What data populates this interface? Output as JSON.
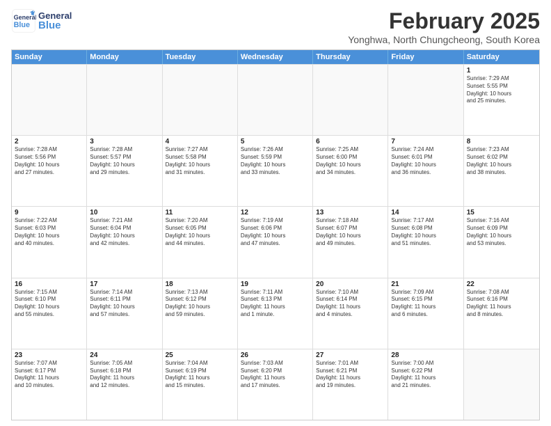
{
  "header": {
    "logo_general": "General",
    "logo_blue": "Blue",
    "title": "February 2025",
    "subtitle": "Yonghwa, North Chungcheong, South Korea"
  },
  "days_of_week": [
    "Sunday",
    "Monday",
    "Tuesday",
    "Wednesday",
    "Thursday",
    "Friday",
    "Saturday"
  ],
  "weeks": [
    [
      {
        "num": "",
        "text": "",
        "empty": true
      },
      {
        "num": "",
        "text": "",
        "empty": true
      },
      {
        "num": "",
        "text": "",
        "empty": true
      },
      {
        "num": "",
        "text": "",
        "empty": true
      },
      {
        "num": "",
        "text": "",
        "empty": true
      },
      {
        "num": "",
        "text": "",
        "empty": true
      },
      {
        "num": "1",
        "text": "Sunrise: 7:29 AM\nSunset: 5:55 PM\nDaylight: 10 hours\nand 25 minutes."
      }
    ],
    [
      {
        "num": "2",
        "text": "Sunrise: 7:28 AM\nSunset: 5:56 PM\nDaylight: 10 hours\nand 27 minutes."
      },
      {
        "num": "3",
        "text": "Sunrise: 7:28 AM\nSunset: 5:57 PM\nDaylight: 10 hours\nand 29 minutes."
      },
      {
        "num": "4",
        "text": "Sunrise: 7:27 AM\nSunset: 5:58 PM\nDaylight: 10 hours\nand 31 minutes."
      },
      {
        "num": "5",
        "text": "Sunrise: 7:26 AM\nSunset: 5:59 PM\nDaylight: 10 hours\nand 33 minutes."
      },
      {
        "num": "6",
        "text": "Sunrise: 7:25 AM\nSunset: 6:00 PM\nDaylight: 10 hours\nand 34 minutes."
      },
      {
        "num": "7",
        "text": "Sunrise: 7:24 AM\nSunset: 6:01 PM\nDaylight: 10 hours\nand 36 minutes."
      },
      {
        "num": "8",
        "text": "Sunrise: 7:23 AM\nSunset: 6:02 PM\nDaylight: 10 hours\nand 38 minutes."
      }
    ],
    [
      {
        "num": "9",
        "text": "Sunrise: 7:22 AM\nSunset: 6:03 PM\nDaylight: 10 hours\nand 40 minutes."
      },
      {
        "num": "10",
        "text": "Sunrise: 7:21 AM\nSunset: 6:04 PM\nDaylight: 10 hours\nand 42 minutes."
      },
      {
        "num": "11",
        "text": "Sunrise: 7:20 AM\nSunset: 6:05 PM\nDaylight: 10 hours\nand 44 minutes."
      },
      {
        "num": "12",
        "text": "Sunrise: 7:19 AM\nSunset: 6:06 PM\nDaylight: 10 hours\nand 47 minutes."
      },
      {
        "num": "13",
        "text": "Sunrise: 7:18 AM\nSunset: 6:07 PM\nDaylight: 10 hours\nand 49 minutes."
      },
      {
        "num": "14",
        "text": "Sunrise: 7:17 AM\nSunset: 6:08 PM\nDaylight: 10 hours\nand 51 minutes."
      },
      {
        "num": "15",
        "text": "Sunrise: 7:16 AM\nSunset: 6:09 PM\nDaylight: 10 hours\nand 53 minutes."
      }
    ],
    [
      {
        "num": "16",
        "text": "Sunrise: 7:15 AM\nSunset: 6:10 PM\nDaylight: 10 hours\nand 55 minutes."
      },
      {
        "num": "17",
        "text": "Sunrise: 7:14 AM\nSunset: 6:11 PM\nDaylight: 10 hours\nand 57 minutes."
      },
      {
        "num": "18",
        "text": "Sunrise: 7:13 AM\nSunset: 6:12 PM\nDaylight: 10 hours\nand 59 minutes."
      },
      {
        "num": "19",
        "text": "Sunrise: 7:11 AM\nSunset: 6:13 PM\nDaylight: 11 hours\nand 1 minute."
      },
      {
        "num": "20",
        "text": "Sunrise: 7:10 AM\nSunset: 6:14 PM\nDaylight: 11 hours\nand 4 minutes."
      },
      {
        "num": "21",
        "text": "Sunrise: 7:09 AM\nSunset: 6:15 PM\nDaylight: 11 hours\nand 6 minutes."
      },
      {
        "num": "22",
        "text": "Sunrise: 7:08 AM\nSunset: 6:16 PM\nDaylight: 11 hours\nand 8 minutes."
      }
    ],
    [
      {
        "num": "23",
        "text": "Sunrise: 7:07 AM\nSunset: 6:17 PM\nDaylight: 11 hours\nand 10 minutes."
      },
      {
        "num": "24",
        "text": "Sunrise: 7:05 AM\nSunset: 6:18 PM\nDaylight: 11 hours\nand 12 minutes."
      },
      {
        "num": "25",
        "text": "Sunrise: 7:04 AM\nSunset: 6:19 PM\nDaylight: 11 hours\nand 15 minutes."
      },
      {
        "num": "26",
        "text": "Sunrise: 7:03 AM\nSunset: 6:20 PM\nDaylight: 11 hours\nand 17 minutes."
      },
      {
        "num": "27",
        "text": "Sunrise: 7:01 AM\nSunset: 6:21 PM\nDaylight: 11 hours\nand 19 minutes."
      },
      {
        "num": "28",
        "text": "Sunrise: 7:00 AM\nSunset: 6:22 PM\nDaylight: 11 hours\nand 21 minutes."
      },
      {
        "num": "",
        "text": "",
        "empty": true
      }
    ]
  ]
}
